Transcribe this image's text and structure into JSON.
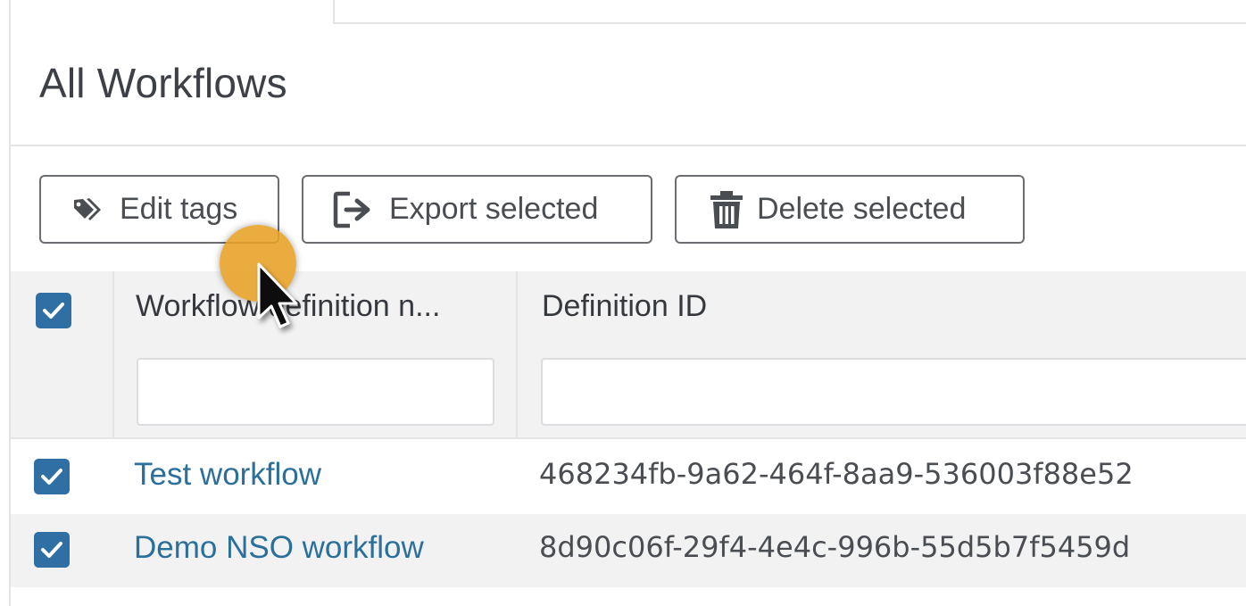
{
  "page": {
    "title": "All Workflows"
  },
  "toolbar": {
    "edit_tags_label": "Edit tags",
    "export_selected_label": "Export selected",
    "delete_selected_label": "Delete selected"
  },
  "table": {
    "columns": [
      {
        "label": "Workflow definition n...",
        "filter_value": ""
      },
      {
        "label": "Definition ID",
        "filter_value": ""
      }
    ],
    "select_all_checked": true,
    "rows": [
      {
        "name": "Test workflow",
        "definition_id": "468234fb-9a62-464f-8aa9-536003f88e52",
        "checked": true
      },
      {
        "name": "Demo NSO workflow",
        "definition_id": "8d90c06f-29f4-4e4c-996b-55d5b7f5459d",
        "checked": true
      }
    ]
  },
  "icons": {
    "edit_tags": "tags-icon",
    "export_selected": "export-icon",
    "delete_selected": "trash-icon",
    "checkbox": "checkmark-icon"
  },
  "colors": {
    "link": "#2b6f9b",
    "checkbox": "#2f6fa3",
    "cursor_highlight": "#e8a024"
  }
}
